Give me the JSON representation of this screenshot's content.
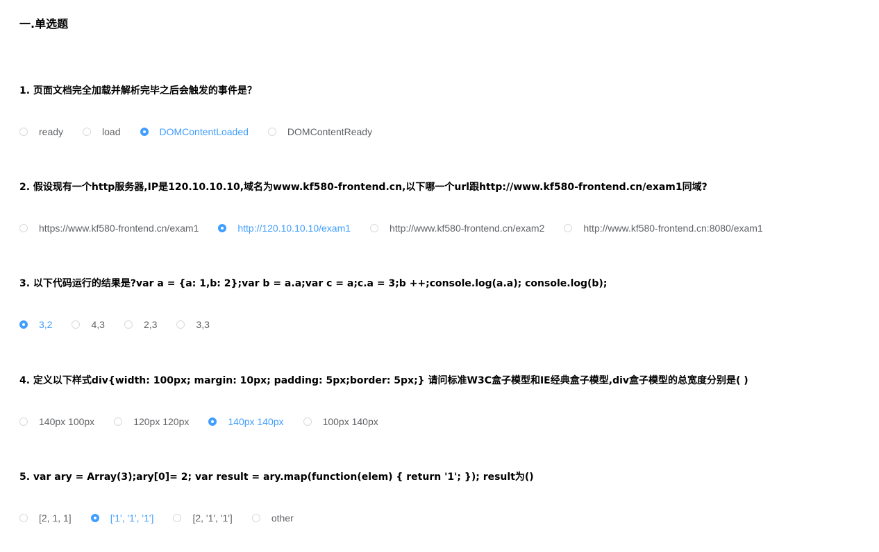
{
  "section_title": "一.单选题",
  "questions": [
    {
      "text": "1. 页面文档完全加载并解析完毕之后会触发的事件是？",
      "options": [
        "ready",
        "load",
        "DOMContentLoaded",
        "DOMContentReady"
      ],
      "selected": 2
    },
    {
      "text": "2. 假设现有一个http服务器,IP是120.10.10.10,域名为www.kf580-frontend.cn,以下哪一个url跟http://www.kf580-frontend.cn/exam1同域?",
      "options": [
        "https://www.kf580-frontend.cn/exam1",
        "http://120.10.10.10/exam1",
        "http://www.kf580-frontend.cn/exam2",
        "http://www.kf580-frontend.cn:8080/exam1"
      ],
      "selected": 1
    },
    {
      "text": "3. 以下代码运行的结果是?var a = {a: 1,b: 2};var b = a.a;var c = a;c.a = 3;b ++;console.log(a.a); console.log(b);",
      "options": [
        "3,2",
        "4,3",
        "2,3",
        "3,3"
      ],
      "selected": 0
    },
    {
      "text": "4. 定义以下样式div{width: 100px; margin: 10px; padding: 5px;border: 5px;} 请问标准W3C盒子模型和IE经典盒子模型,div盒子模型的总宽度分别是( )",
      "options": [
        "140px 100px",
        "120px 120px",
        "140px 140px",
        "100px 140px"
      ],
      "selected": 2
    },
    {
      "text": "5. var ary = Array(3);ary[0]= 2; var result = ary.map(function(elem) { return '1'; }); result为()",
      "options": [
        "[2, 1, 1]",
        "['1', '1', '1']",
        "[2, '1', '1']",
        "other"
      ],
      "selected": 1
    }
  ],
  "colors": {
    "accent": "#409eff",
    "option_text": "#606266",
    "radio_border": "#d9d9d9"
  }
}
